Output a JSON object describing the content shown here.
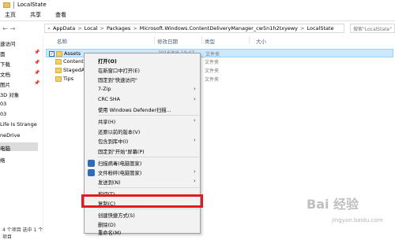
{
  "window": {
    "title": "LocalState"
  },
  "ribbon": {
    "tabs": [
      "主页",
      "共享",
      "查看"
    ]
  },
  "address": {
    "back": "←",
    "forward": "→",
    "crumbs": [
      "«",
      "AppData",
      ">",
      "Local",
      ">",
      "Packages",
      ">",
      "Microsoft.Windows.ContentDeliveryManager_cw5n1h2txyewy",
      ">",
      "LocalState"
    ],
    "search_placeholder": "搜索\"LocalState\""
  },
  "sidebar": {
    "items": [
      {
        "label": "速访问",
        "pinned": false
      },
      {
        "label": "面",
        "pinned": true
      },
      {
        "label": "下载",
        "pinned": true
      },
      {
        "label": "文档",
        "pinned": true
      },
      {
        "label": "图片",
        "pinned": true
      },
      {
        "label": "3D 对象",
        "pinned": false
      },
      {
        "label": "03",
        "pinned": false
      },
      {
        "label": "03",
        "pinned": false
      },
      {
        "label": "Life Is Strange",
        "pinned": false
      },
      {
        "label": "neDrive",
        "pinned": false
      },
      {
        "label": "电脑",
        "pinned": false,
        "selected": true
      },
      {
        "label": "络",
        "pinned": false
      }
    ]
  },
  "columns": {
    "name": "名称",
    "date": "修改日期",
    "type": "类型",
    "size": "大小"
  },
  "files": [
    {
      "name": "Assets",
      "date": "2016/8/6 10:47",
      "type": "文件夹",
      "selected": true
    },
    {
      "name": "ContentM",
      "date": "",
      "type": "文件夹",
      "selected": false
    },
    {
      "name": "StagedA",
      "date": "",
      "type": "文件夹",
      "selected": false
    },
    {
      "name": "Tips",
      "date": "",
      "type": "文件夹",
      "selected": false
    }
  ],
  "context_menu": {
    "items": [
      {
        "label": "打开(O)",
        "bold": true
      },
      {
        "label": "在新窗口中打开(E)"
      },
      {
        "label": "固定到\"快速访问\""
      },
      {
        "label": "7-Zip",
        "submenu": true
      },
      {
        "label": "CRC SHA",
        "submenu": true
      },
      {
        "label": "使用 Windows Defender扫描..."
      },
      {
        "label": "共享(H)",
        "submenu": true
      },
      {
        "label": "还原以前的版本(V)"
      },
      {
        "label": "包含到库中(I)",
        "submenu": true
      },
      {
        "label": "固定到\"开始\"屏幕(P)"
      },
      {
        "label": "扫描病毒(电脑管家)",
        "icon": "shield-icon"
      },
      {
        "label": "文件粉碎(电脑管家)",
        "icon": "shield-icon",
        "submenu": true
      },
      {
        "label": "发送到(N)",
        "submenu": true
      },
      {
        "label": "剪切(T)"
      },
      {
        "label": "复制(C)",
        "highlighted": true
      },
      {
        "label": "创建快捷方式(S)"
      },
      {
        "label": "删除(D)"
      },
      {
        "label": "重命名(M)"
      }
    ]
  },
  "status": {
    "text": "4 个项目 选中 1 个项目"
  },
  "colors": {
    "highlight_border": "#e11b22",
    "selected_row": "#cce8ff",
    "folder": "#f4cf62"
  },
  "watermark": {
    "text": "Bai 经验",
    "sub": "jingyan.baidu.com"
  }
}
